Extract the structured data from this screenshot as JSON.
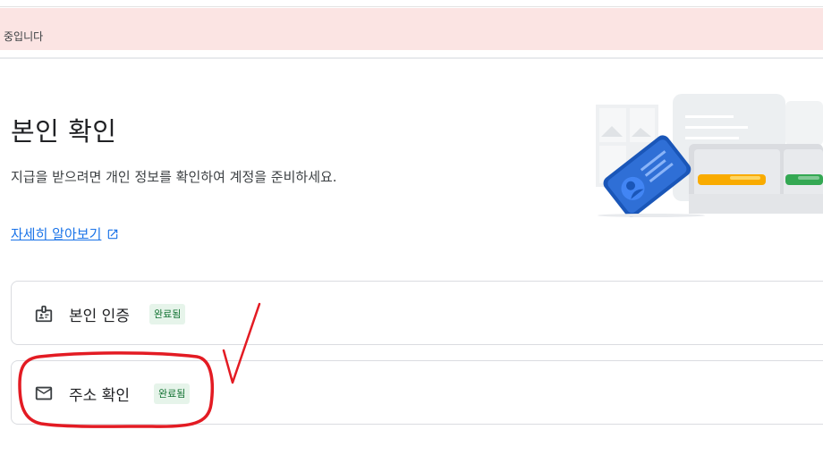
{
  "banner": {
    "text": "중입니다"
  },
  "header": {
    "title": "본인 확인",
    "description": "지급을 받으려면 개인 정보를 확인하여 계정을 준비하세요.",
    "learn_more": "자세히 알아보기"
  },
  "steps": [
    {
      "label": "본인 인증",
      "status": "완료됨",
      "icon": "id-badge-icon"
    },
    {
      "label": "주소 확인",
      "status": "완료됨",
      "icon": "mail-icon"
    }
  ],
  "colors": {
    "banner_bg": "#fbe4e3",
    "link": "#1a73e8",
    "badge_bg": "#e6f4ea",
    "badge_text": "#137333",
    "annotation": "#e31b23"
  }
}
